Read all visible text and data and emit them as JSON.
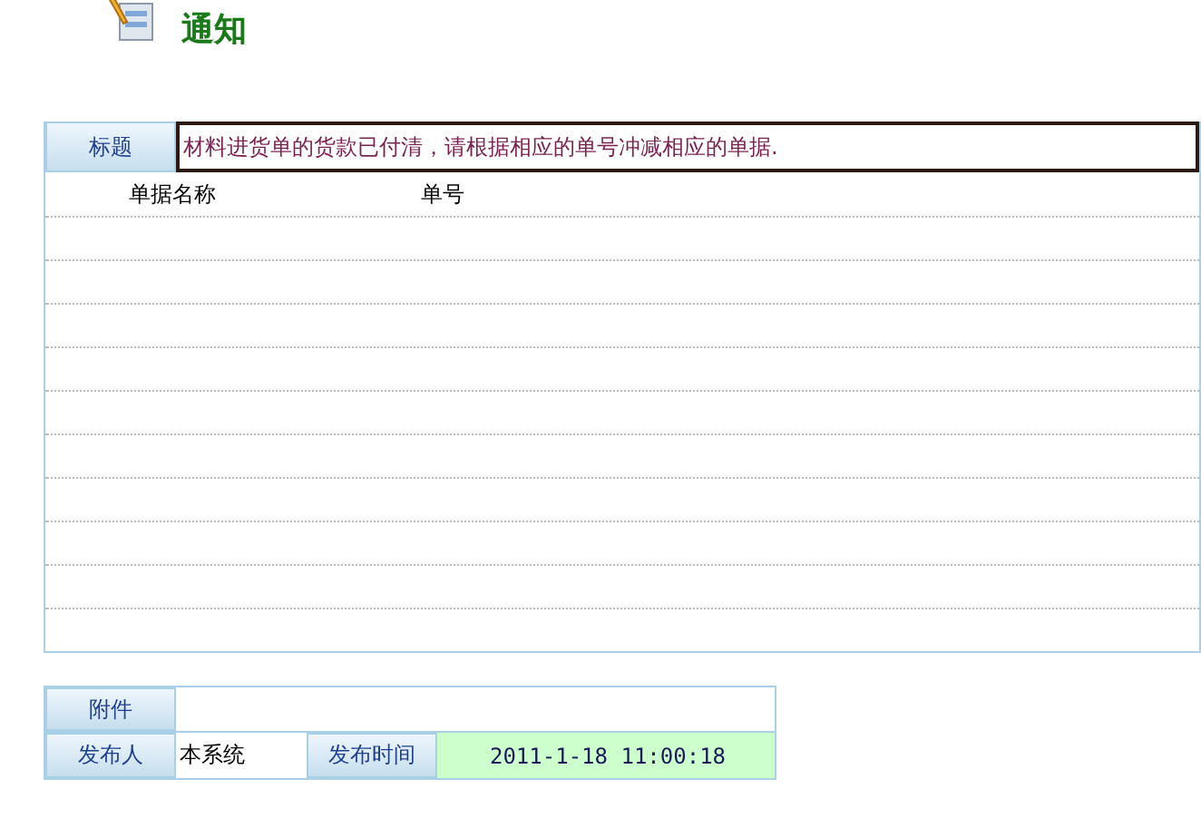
{
  "page": {
    "title": "通知"
  },
  "notice": {
    "subject_label": "标题",
    "subject": "材料进货单的货款已付清，请根据相应的单号冲减相应的单据.",
    "columns": [
      "单据名称",
      "单号"
    ]
  },
  "info": {
    "attachment_label": "附件",
    "publisher_label": "发布人",
    "publisher": "本系统",
    "time_label": "发布时间",
    "time": "2011-1-18 11:00:18"
  }
}
